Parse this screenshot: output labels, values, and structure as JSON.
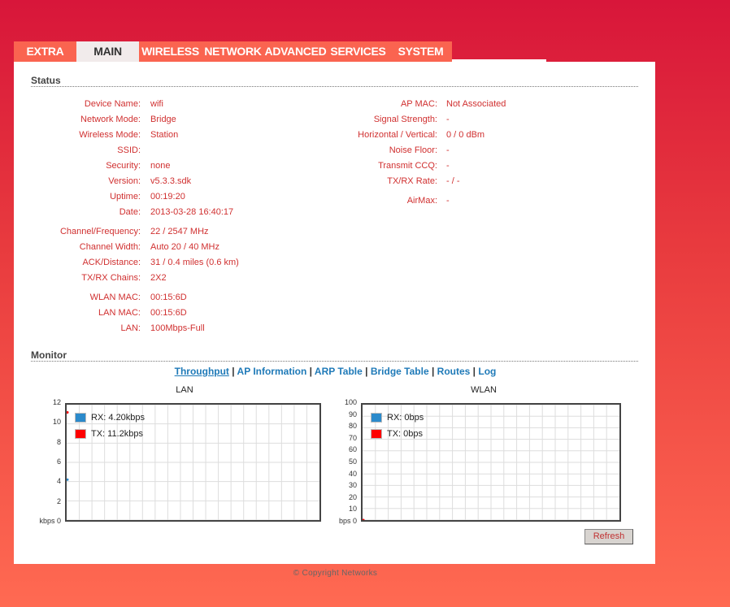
{
  "tabs": [
    "EXTRA",
    "MAIN",
    "WIRELESS",
    "NETWORK",
    "ADVANCED",
    "SERVICES",
    "SYSTEM"
  ],
  "status": {
    "heading": "Status",
    "left": [
      {
        "label": "Device Name:",
        "value": "wifi"
      },
      {
        "label": "Network Mode:",
        "value": "Bridge"
      },
      {
        "label": "Wireless Mode:",
        "value": "Station"
      },
      {
        "label": "SSID:",
        "value": ""
      },
      {
        "label": "Security:",
        "value": "none"
      },
      {
        "label": "Version:",
        "value": "v5.3.3.sdk"
      },
      {
        "label": "Uptime:",
        "value": "00:19:20"
      },
      {
        "label": "Date:",
        "value": "2013-03-28 16:40:17"
      },
      {
        "label": "Channel/Frequency:",
        "value": "22 / 2547 MHz"
      },
      {
        "label": "Channel Width:",
        "value": "Auto 20 / 40 MHz"
      },
      {
        "label": "ACK/Distance:",
        "value": "31 / 0.4 miles (0.6 km)"
      },
      {
        "label": "TX/RX Chains:",
        "value": "2X2"
      },
      {
        "label": "WLAN MAC:",
        "value": "00:15:6D"
      },
      {
        "label": "LAN MAC:",
        "value": "00:15:6D"
      },
      {
        "label": "LAN:",
        "value": "100Mbps-Full"
      }
    ],
    "right": [
      {
        "label": "AP MAC:",
        "value": "Not Associated"
      },
      {
        "label": "Signal Strength:",
        "value": "-"
      },
      {
        "label": "Horizontal / Vertical:",
        "value": "0 / 0 dBm"
      },
      {
        "label": "Noise Floor:",
        "value": "-"
      },
      {
        "label": "Transmit CCQ:",
        "value": "-"
      },
      {
        "label": "TX/RX Rate:",
        "value": "- / -"
      },
      {
        "label": "AirMax:",
        "value": "-"
      }
    ]
  },
  "monitor": {
    "heading": "Monitor",
    "links": [
      "Throughput",
      "AP Information",
      "ARP Table",
      "Bridge Table",
      "Routes",
      "Log"
    ],
    "refresh": "Refresh"
  },
  "chart_data": [
    {
      "type": "line",
      "title": "LAN",
      "ylabel": "kbps",
      "ylim": [
        0,
        12
      ],
      "yticks": [
        0,
        2,
        4,
        6,
        8,
        10,
        12
      ],
      "series": [
        {
          "name": "RX: 4.20kbps",
          "color": "#2b8acb",
          "values": [
            4.2
          ]
        },
        {
          "name": "TX: 11.2kbps",
          "color": "#ff0000",
          "values": [
            11.2
          ]
        }
      ]
    },
    {
      "type": "line",
      "title": "WLAN",
      "ylabel": "bps",
      "ylim": [
        0,
        100
      ],
      "yticks": [
        0,
        10,
        20,
        30,
        40,
        50,
        60,
        70,
        80,
        90,
        100
      ],
      "series": [
        {
          "name": "RX: 0bps",
          "color": "#2b8acb",
          "values": [
            0
          ]
        },
        {
          "name": "TX: 0bps",
          "color": "#ff0000",
          "values": [
            0
          ]
        }
      ]
    }
  ],
  "copyright": "© Copyright Networks"
}
